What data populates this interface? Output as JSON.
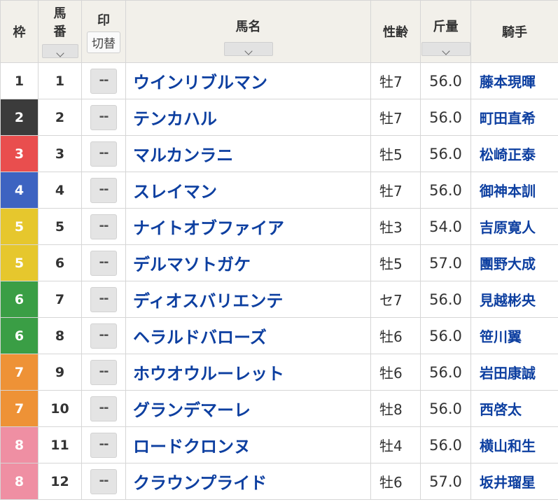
{
  "header": {
    "waku": "枠",
    "umaban_top": "馬",
    "umaban_bottom": "番",
    "mark": "印",
    "mark_switch": "切替",
    "name": "馬名",
    "sexage": "性齢",
    "weight": "斤量",
    "jockey": "騎手"
  },
  "mark_placeholder": "--",
  "waku_colors": {
    "1": {
      "bg": "#ffffff",
      "fg": "#333333"
    },
    "2": {
      "bg": "#3b3b3b",
      "fg": "#ffffff"
    },
    "3": {
      "bg": "#e94e4e",
      "fg": "#ffffff"
    },
    "4": {
      "bg": "#3d63c1",
      "fg": "#ffffff"
    },
    "5": {
      "bg": "#e6c72d",
      "fg": "#ffffff"
    },
    "6": {
      "bg": "#3a9e45",
      "fg": "#ffffff"
    },
    "7": {
      "bg": "#ee9236",
      "fg": "#ffffff"
    },
    "8": {
      "bg": "#ef8fa3",
      "fg": "#ffffff"
    }
  },
  "rows": [
    {
      "waku": "1",
      "umaban": "1",
      "name": "ウインリブルマン",
      "sexage": "牡7",
      "weight": "56.0",
      "jockey": "藤本現暉"
    },
    {
      "waku": "2",
      "umaban": "2",
      "name": "テンカハル",
      "sexage": "牡7",
      "weight": "56.0",
      "jockey": "町田直希"
    },
    {
      "waku": "3",
      "umaban": "3",
      "name": "マルカンラニ",
      "sexage": "牡5",
      "weight": "56.0",
      "jockey": "松崎正泰"
    },
    {
      "waku": "4",
      "umaban": "4",
      "name": "スレイマン",
      "sexage": "牡7",
      "weight": "56.0",
      "jockey": "御神本訓"
    },
    {
      "waku": "5",
      "umaban": "5",
      "name": "ナイトオブファイア",
      "sexage": "牡3",
      "weight": "54.0",
      "jockey": "吉原寛人"
    },
    {
      "waku": "5",
      "umaban": "6",
      "name": "デルマソトガケ",
      "sexage": "牡5",
      "weight": "57.0",
      "jockey": "團野大成"
    },
    {
      "waku": "6",
      "umaban": "7",
      "name": "ディオスバリエンテ",
      "sexage": "セ7",
      "weight": "56.0",
      "jockey": "見越彬央"
    },
    {
      "waku": "6",
      "umaban": "8",
      "name": "ヘラルドバローズ",
      "sexage": "牡6",
      "weight": "56.0",
      "jockey": "笹川翼"
    },
    {
      "waku": "7",
      "umaban": "9",
      "name": "ホウオウルーレット",
      "sexage": "牡6",
      "weight": "56.0",
      "jockey": "岩田康誠"
    },
    {
      "waku": "7",
      "umaban": "10",
      "name": "グランデマーレ",
      "sexage": "牡8",
      "weight": "56.0",
      "jockey": "西啓太"
    },
    {
      "waku": "8",
      "umaban": "11",
      "name": "ロードクロンヌ",
      "sexage": "牡4",
      "weight": "56.0",
      "jockey": "横山和生"
    },
    {
      "waku": "8",
      "umaban": "12",
      "name": "クラウンプライド",
      "sexage": "牡6",
      "weight": "57.0",
      "jockey": "坂井瑠星"
    }
  ]
}
